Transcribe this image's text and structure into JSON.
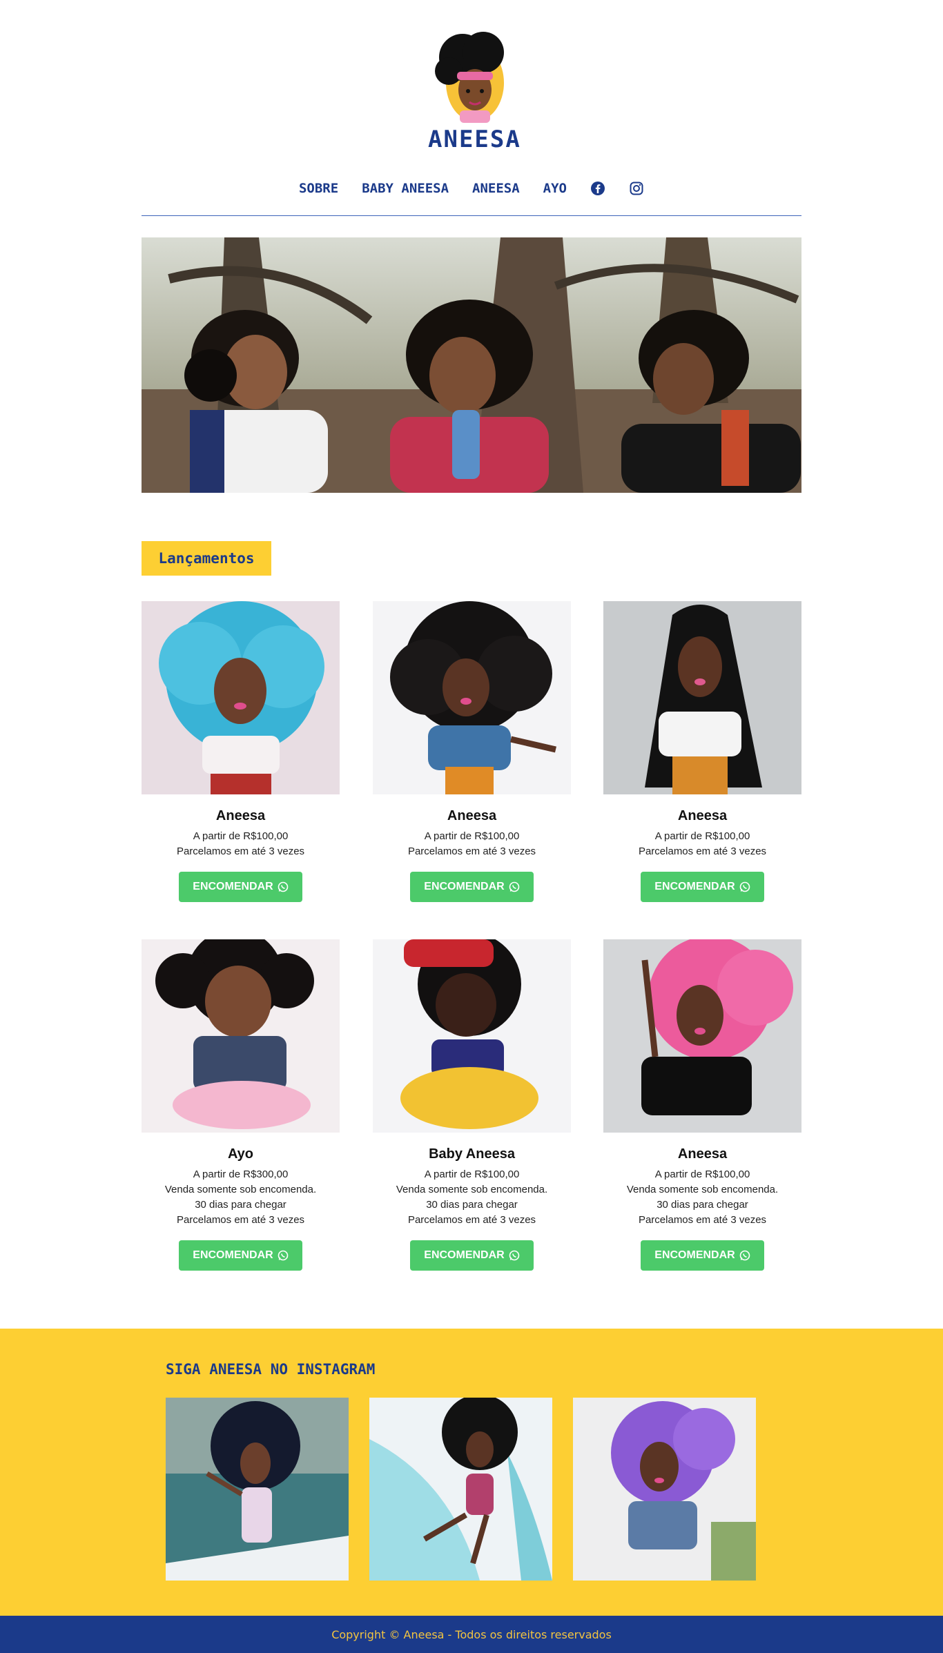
{
  "brand": {
    "name": "ANEESA"
  },
  "nav": {
    "items": [
      "Sobre",
      "Baby Aneesa",
      "Aneesa",
      "Ayo"
    ],
    "social": [
      "facebook-icon",
      "instagram-icon"
    ]
  },
  "colors": {
    "brand_blue": "#1b3a8a",
    "brand_yellow": "#fdcf33",
    "cta_green": "#4cca6a"
  },
  "section": {
    "title": "Lançamentos"
  },
  "products": [
    {
      "name": "Aneesa",
      "lines": [
        "A partir de R$100,00",
        "Parcelamos em até 3 vezes"
      ],
      "button": "ENCOMENDAR"
    },
    {
      "name": "Aneesa",
      "lines": [
        "A partir de R$100,00",
        "Parcelamos em até 3 vezes"
      ],
      "button": "ENCOMENDAR"
    },
    {
      "name": "Aneesa",
      "lines": [
        "A partir de R$100,00",
        "Parcelamos em até 3 vezes"
      ],
      "button": "ENCOMENDAR"
    },
    {
      "name": "Ayo",
      "lines": [
        "A partir de R$300,00",
        "Venda somente sob encomenda.",
        "30 dias para chegar",
        "Parcelamos em até 3 vezes"
      ],
      "button": "ENCOMENDAR"
    },
    {
      "name": "Baby Aneesa",
      "lines": [
        "A partir de R$100,00",
        "Venda somente sob encomenda.",
        "30 dias para chegar",
        "Parcelamos em até 3 vezes"
      ],
      "button": "ENCOMENDAR"
    },
    {
      "name": "Aneesa",
      "lines": [
        "A partir de R$100,00",
        "Venda somente sob encomenda.",
        "30 dias para chegar",
        "Parcelamos em até 3 vezes"
      ],
      "button": "ENCOMENDAR"
    }
  ],
  "instagram": {
    "title": "SIGA ANEESA NO INSTAGRAM"
  },
  "footer": {
    "text": "Copyright © Aneesa - Todos os direitos reservados"
  }
}
